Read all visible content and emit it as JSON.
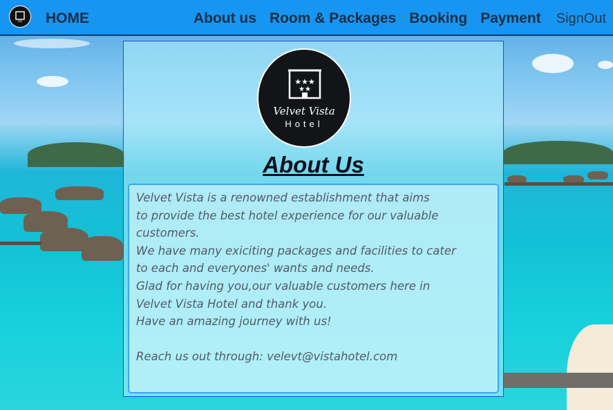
{
  "nav": {
    "home": "HOME",
    "links": [
      "About us",
      "Room & Packages",
      "Booking",
      "Payment"
    ],
    "signout": "SignOut"
  },
  "logo": {
    "name": "Velvet Vista",
    "sub": "Hotel"
  },
  "page_title": "About Us",
  "about_text": [
    "Velvet Vista is a renowned establishment that aims",
    "to provide the best hotel experience for our valuable",
    "customers.",
    "We have many exiciting packages and facilities to cater",
    "to each and everyones' wants and needs.",
    "Glad for having you,our valuable customers here in",
    "Velvet Vista Hotel and thank you.",
    "Have an amazing journey with us!",
    "",
    "Reach us out through: velevt@vistahotel.com"
  ],
  "colors": {
    "navbar": "#1795f2",
    "nav_text": "#1c2e44",
    "panel_border": "#1b4fd8",
    "textbox_border": "#36a8ef"
  }
}
